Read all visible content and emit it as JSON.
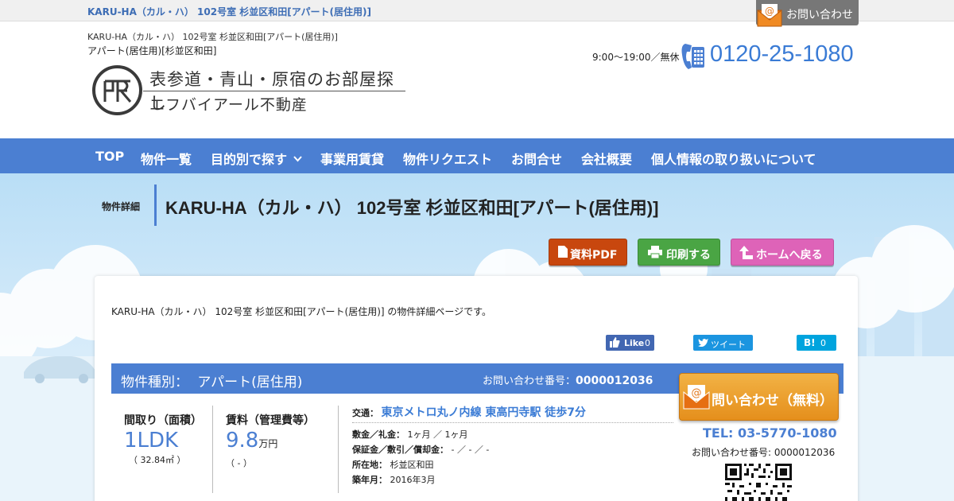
{
  "top_bar": {
    "breadcrumb": "KARU-HA（カル・ハ） 102号室 杉並区和田[アパート(居住用)]",
    "contact_label": "お問い合わせ"
  },
  "header": {
    "line1": "KARU-HA（カル・ハ） 102号室 杉並区和田[アパート(居住用)]",
    "line2": "アパート(居住用)[杉並区和田]",
    "logo_line1": "表参道・青山・原宿のお部屋探し",
    "logo_line2": "エフバイアール不動産",
    "hours": "9:00～19:00／無休",
    "phone": "0120-25-1080"
  },
  "nav": {
    "items": [
      "TOP",
      "物件一覧",
      "目的別で探す",
      "事業用賃貸",
      "物件リクエスト",
      "お問合せ",
      "会社概要",
      "個人情報の取り扱いについて"
    ]
  },
  "page": {
    "label": "物件詳細",
    "title": "KARU-HA（カル・ハ） 102号室 杉並区和田[アパート(居住用)]",
    "intro": "KARU-HA（カル・ハ） 102号室 杉並区和田[アパート(居住用)] の物件詳細ページです。"
  },
  "actions": {
    "pdf": "資料PDF",
    "print": "印刷する",
    "home": "ホームへ戻る"
  },
  "social": {
    "fb_label": "Like",
    "fb_count": "0",
    "tw_label": "ツイート",
    "hb_label": "B!",
    "hb_count": "0"
  },
  "property": {
    "type_label": "物件種別：",
    "type_value": "アパート(居住用)",
    "inquiry_label": "お問い合わせ番号：",
    "inquiry_number": "0000012036",
    "layout_heading": "間取り（面積）",
    "layout_value": "1LDK",
    "area": "（ 32.84㎡ ）",
    "rent_heading": "賃料（管理費等）",
    "rent_value": "9.8",
    "rent_unit": "万円",
    "fee": "（ - ）",
    "transport_label": "交通：",
    "transport_value": "東京メトロ丸ノ内線 東高円寺駅 徒歩7分",
    "deposit_label": "敷金／礼金：",
    "deposit_value": "1ヶ月 ／ 1ヶ月",
    "guarantee_label": "保証金／敷引／償却金：",
    "guarantee_value": "- ／ - ／ -",
    "address_label": "所在地：",
    "address_value": "杉並区和田",
    "built_label": "築年月：",
    "built_value": "2016年3月"
  },
  "cta": {
    "button": "問い合わせ（無料）",
    "tel": "TEL: 03-5770-1080",
    "inquiry_line": "お問い合わせ番号: 0000012036"
  },
  "colors": {
    "brand_blue": "#4b7fd2",
    "pdf_orange": "#c8470e",
    "print_green": "#4aa544",
    "home_pink": "#de63b8",
    "cta_orange": "#e58f1c"
  }
}
